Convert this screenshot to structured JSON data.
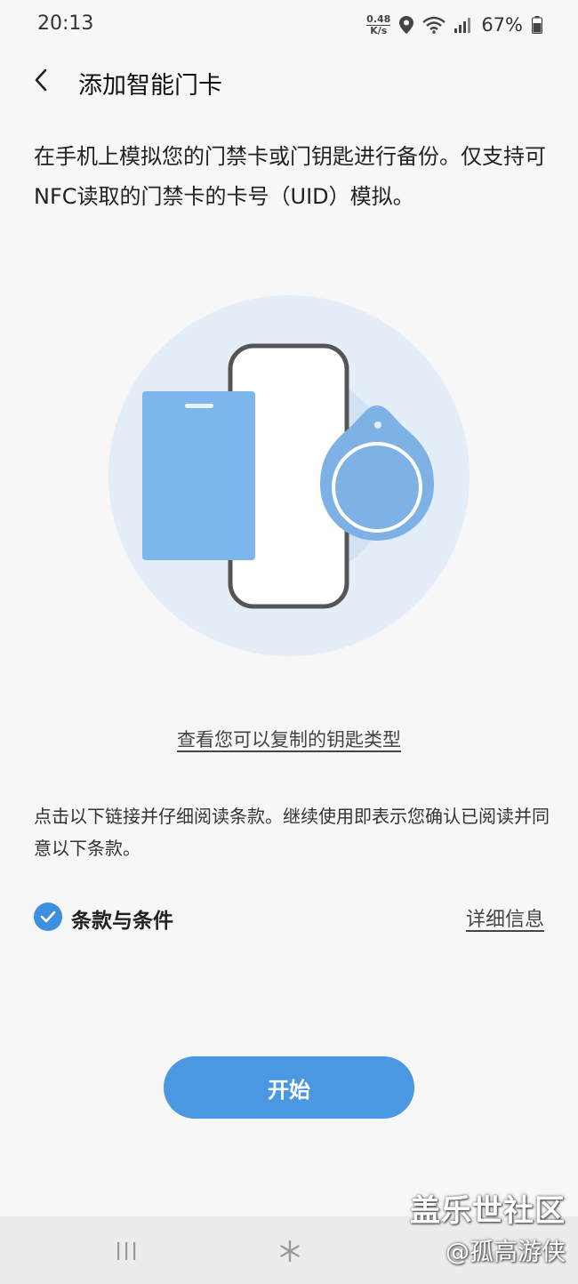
{
  "status_bar": {
    "time": "20:13",
    "net_speed_value": "0.48",
    "net_speed_unit": "K/s",
    "battery": "67%",
    "icons": [
      "location-icon",
      "wifi-icon",
      "signal-icon",
      "battery-icon"
    ]
  },
  "header": {
    "back_icon": "chevron-left-icon",
    "title": "添加智能门卡"
  },
  "description": "在手机上模拟您的门禁卡或门钥匙进行备份。仅支持可NFC读取的门禁卡的卡号（UID）模拟。",
  "illustration": {
    "icons": [
      "access-card-icon",
      "phone-icon",
      "key-fob-icon"
    ],
    "colors": {
      "outer_circle": "#e4eef8",
      "inner_circle": "#d2e2f2",
      "card": "#7cb6ec",
      "fob": "#7eb2e6",
      "phone_frame": "#555555"
    }
  },
  "key_types_link": "查看您可以复制的钥匙类型",
  "terms_note": "点击以下链接并仔细阅读条款。继续使用即表示您确认已阅读并同意以下条款。",
  "terms": {
    "checked": true,
    "label": "条款与条件",
    "details_link": "详细信息"
  },
  "start_button": "开始",
  "nav_bar": {
    "recents_icon": "recents-icon",
    "home_icon": "home-icon"
  },
  "watermark": {
    "site": "盖乐世社区",
    "author": "@孤高游侠"
  },
  "colors": {
    "accent": "#4a97e2",
    "background": "#f7f7f7"
  }
}
